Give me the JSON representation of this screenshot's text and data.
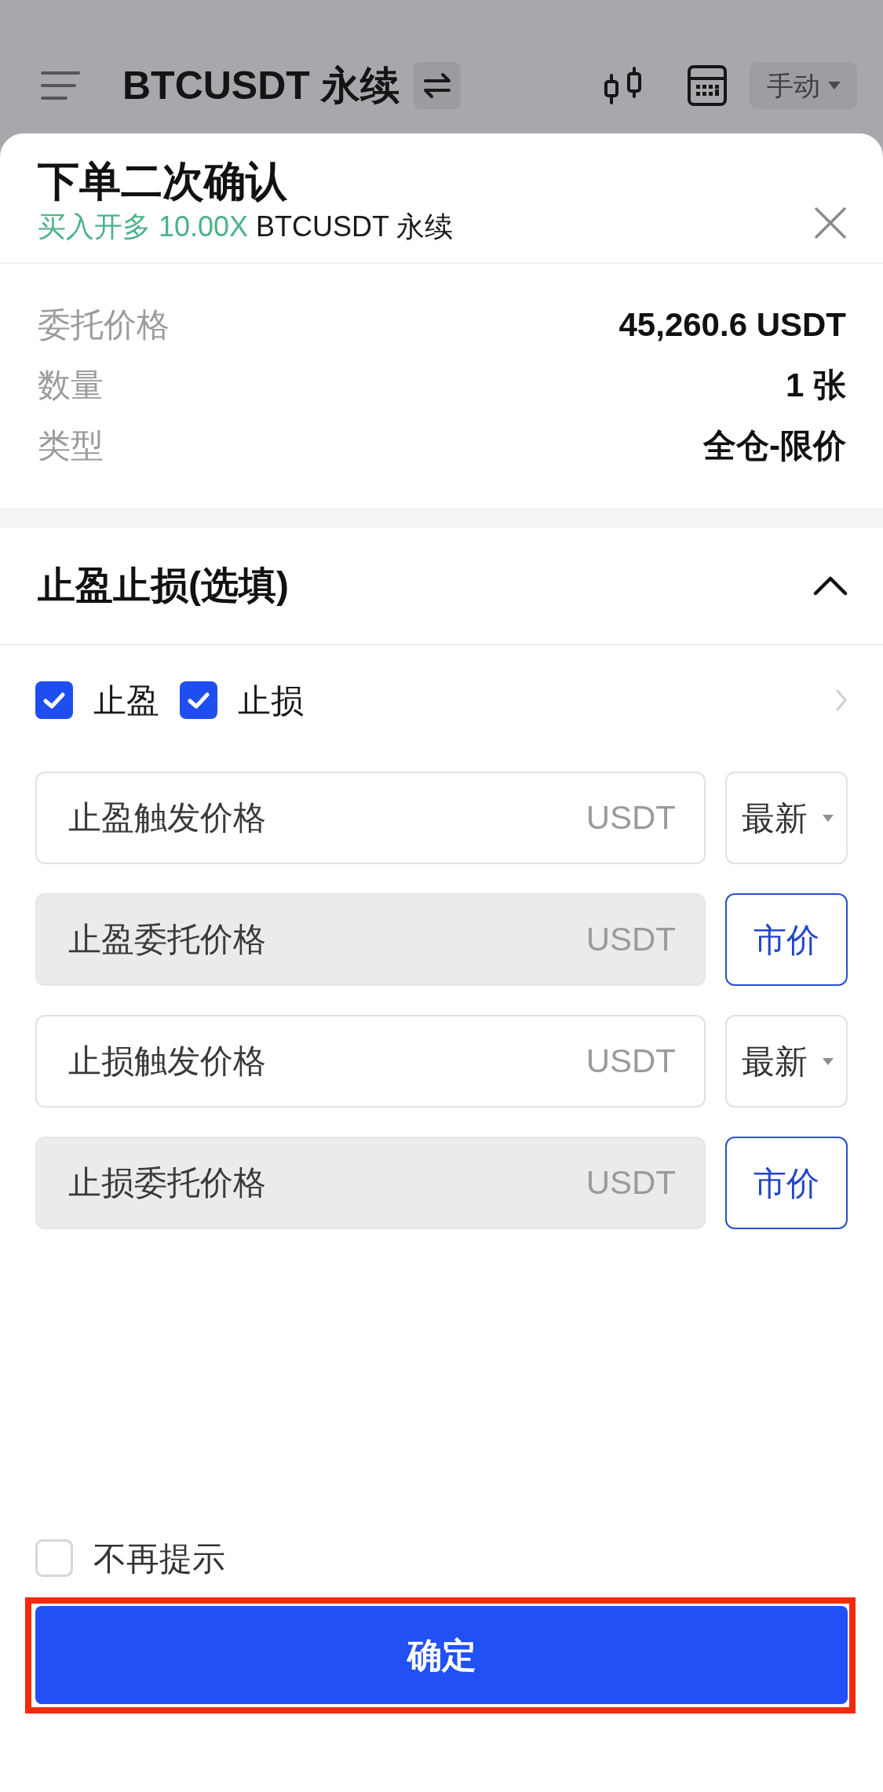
{
  "app_bar": {
    "title": "BTCUSDT 永续",
    "mode": "手动"
  },
  "dialog": {
    "title": "下单二次确认",
    "order_side": "买入开多 10.00X",
    "symbol": "BTCUSDT 永续"
  },
  "order_details": [
    {
      "label": "委托价格",
      "value": "45,260.6 USDT"
    },
    {
      "label": "数量",
      "value": "1 张"
    },
    {
      "label": "类型",
      "value": "全仓-限价"
    }
  ],
  "tp_sl": {
    "title": "止盈止损(选填)",
    "expanded": true,
    "options": [
      {
        "label": "止盈",
        "checked": true
      },
      {
        "label": "止损",
        "checked": true
      }
    ],
    "fields": [
      {
        "placeholder": "止盈触发价格",
        "unit": "USDT",
        "disabled": false,
        "kind": "dropdown",
        "action": "最新"
      },
      {
        "placeholder": "止盈委托价格",
        "unit": "USDT",
        "disabled": true,
        "kind": "button",
        "action": "市价"
      },
      {
        "placeholder": "止损触发价格",
        "unit": "USDT",
        "disabled": false,
        "kind": "dropdown",
        "action": "最新"
      },
      {
        "placeholder": "止损委托价格",
        "unit": "USDT",
        "disabled": true,
        "kind": "button",
        "action": "市价"
      }
    ]
  },
  "dont_remind": {
    "label": "不再提示",
    "checked": false
  },
  "confirm_button": {
    "label": "确定",
    "highlighted": true
  }
}
